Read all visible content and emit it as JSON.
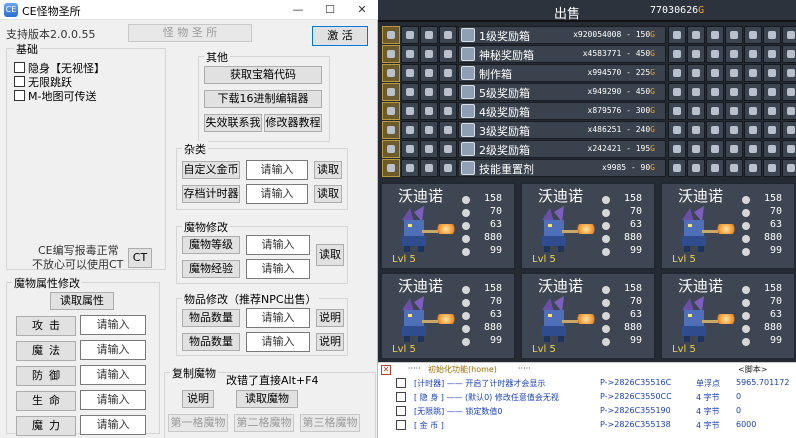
{
  "window": {
    "title": "CE怪物圣所",
    "version": "支持版本2.0.0.55",
    "title_button": "怪 物 圣 所",
    "activate_button": "激 活",
    "minimize": "—",
    "maximize": "☐",
    "close": "✕"
  },
  "basic": {
    "legend": "基础",
    "checkboxes": [
      "隐身【无视怪】",
      "无限跳跃",
      "M-地图可传送"
    ],
    "note_line1": "CE编写报毒正常",
    "note_line2": "不放心可以使用CT",
    "ct_button": "CT"
  },
  "other": {
    "legend": "其他",
    "buttons": [
      "获取宝箱代码",
      "下载16进制编辑器",
      "失效联系我",
      "修改器教程"
    ]
  },
  "misc": {
    "legend": "杂类",
    "rows": [
      {
        "label": "自定义金币",
        "placeholder": "请输入",
        "read": "读取"
      },
      {
        "label": "存档计时器",
        "placeholder": "请输入",
        "read": "读取"
      }
    ]
  },
  "monster_mod": {
    "legend": "魔物修改",
    "rows": [
      {
        "label": "魔物等级",
        "placeholder": "请输入"
      },
      {
        "label": "魔物经验",
        "placeholder": "请输入"
      }
    ],
    "read": "读取"
  },
  "item_mod": {
    "legend": "物品修改（推荐NPC出售）",
    "rows": [
      {
        "label": "物品数量",
        "placeholder": "请输入",
        "info": "说明"
      },
      {
        "label": "物品数量",
        "placeholder": "请输入",
        "info": "说明"
      }
    ]
  },
  "attr_mod": {
    "legend": "魔物属性修改",
    "read_button": "读取属性",
    "rows": [
      {
        "label": "攻击",
        "placeholder": "请输入"
      },
      {
        "label": "魔法",
        "placeholder": "请输入"
      },
      {
        "label": "防御",
        "placeholder": "请输入"
      },
      {
        "label": "生命",
        "placeholder": "请输入"
      },
      {
        "label": "魔力",
        "placeholder": "请输入"
      }
    ]
  },
  "copy_monster": {
    "legend": "复制魔物",
    "hint": "改错了直接Alt+F4",
    "info": "说明",
    "read": "读取魔物",
    "slots": [
      "第一格魔物",
      "第二格魔物",
      "第三格魔物"
    ]
  },
  "game": {
    "sell_title": "出售",
    "gold_value": "77030626",
    "items": [
      {
        "name": "1级奖励箱",
        "price": "x920054008 - 150",
        "coin": "G"
      },
      {
        "name": "神秘奖励箱",
        "price": "x4583771 - 450",
        "coin": "G"
      },
      {
        "name": "制作箱",
        "price": "x994570 - 225",
        "coin": "G"
      },
      {
        "name": "5级奖励箱",
        "price": "x949290 - 450",
        "coin": "G"
      },
      {
        "name": "4级奖励箱",
        "price": "x879576 - 300",
        "coin": "G"
      },
      {
        "name": "3级奖励箱",
        "price": "x486251 - 240",
        "coin": "G"
      },
      {
        "name": "2级奖励箱",
        "price": "x242421 - 195",
        "coin": "G"
      },
      {
        "name": "技能重置剂",
        "price": "x9985 - 90",
        "coin": "G"
      }
    ],
    "monster": {
      "name": "沃迪诺",
      "level": "Lvl 5",
      "stats": [
        "158",
        "70",
        "63",
        "880",
        "99"
      ]
    },
    "card_count": 6
  },
  "ce_table": {
    "header": "初始化功能(home)",
    "header_right": "<脚本>",
    "rows": [
      {
        "name": "[计时器] —— 开启了计时器才会显示",
        "addr": "P->2826C35516C",
        "type": "单浮点",
        "value": "5965.701172"
      },
      {
        "name": "[ 隐 身 ] —— (默认0) 修改任意值会无视",
        "addr": "P->2826C3550CC",
        "type": "4 字节",
        "value": "0"
      },
      {
        "name": "[无限跳] —— 锁定数值0",
        "addr": "P->2826C355190",
        "type": "4 字节",
        "value": "0"
      },
      {
        "name": "[ 金 币 ]",
        "addr": "P->2826C355138",
        "type": "4 字节",
        "value": "6000"
      }
    ]
  },
  "colors": {
    "coin": "#f3a21b",
    "level": "#f3d14a",
    "ce_blue": "#1a3fb8"
  }
}
